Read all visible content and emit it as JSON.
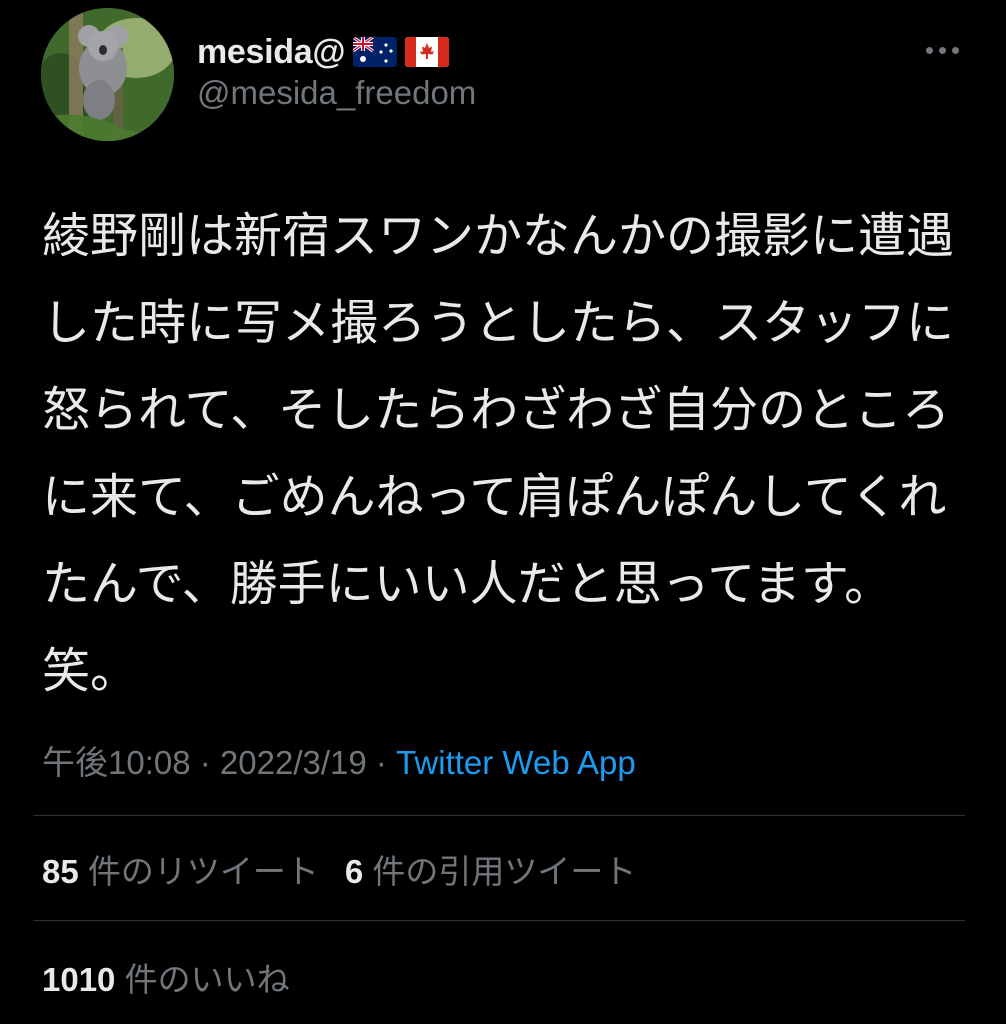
{
  "user": {
    "display_name": "mesida@",
    "flags": [
      "australia-flag",
      "canada-flag"
    ],
    "handle": "@mesida_freedom"
  },
  "tweet": {
    "text": "綾野剛は新宿スワンかなんかの撮影に遭遇した時に写メ撮ろうとしたら、スタッフに怒られて、そしたらわざわざ自分のところに来て、ごめんねって肩ぽんぽんしてくれたんで、勝手にいい人だと思ってます。笑。",
    "time": "午後10:08",
    "sep1": " · ",
    "date": "2022/3/19",
    "sep2": " · ",
    "source": "Twitter Web App"
  },
  "stats": {
    "retweets_count": "85",
    "retweets_label": "件のリツイート",
    "quotes_count": "6",
    "quotes_label": "件の引用ツイート",
    "likes_count": "1010",
    "likes_label": "件のいいね"
  },
  "colors": {
    "background": "#000000",
    "text": "#e7e9ea",
    "secondary": "#71767b",
    "link": "#1d9bf0",
    "divider": "#2f3336"
  }
}
